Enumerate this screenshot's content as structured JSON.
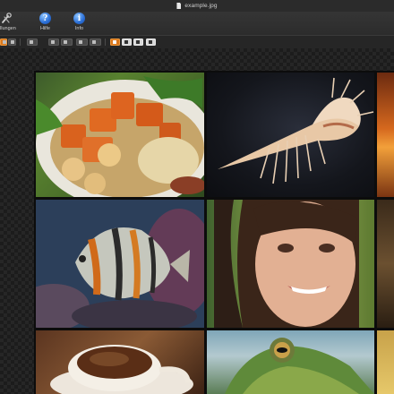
{
  "window": {
    "title": "example.jpg"
  },
  "toolbar": {
    "settings_label": "ellungen",
    "help_label": "Hilfe",
    "info_label": "Info"
  },
  "icons": {
    "settings": "wrench-screwdriver-icon",
    "help": "question-mark-icon",
    "info": "info-icon",
    "document": "document-icon"
  },
  "colors": {
    "accent": "#d9771c",
    "help_blue": "#2a6ed6",
    "background": "#1d1d1d"
  },
  "images": [
    {
      "subject": "food-bowl"
    },
    {
      "subject": "seashell"
    },
    {
      "subject": "fire"
    },
    {
      "subject": "tropical-fish"
    },
    {
      "subject": "smiling-woman"
    },
    {
      "subject": "partial-image"
    },
    {
      "subject": "coffee-cup"
    },
    {
      "subject": "frog"
    },
    {
      "subject": "partial-image"
    }
  ]
}
